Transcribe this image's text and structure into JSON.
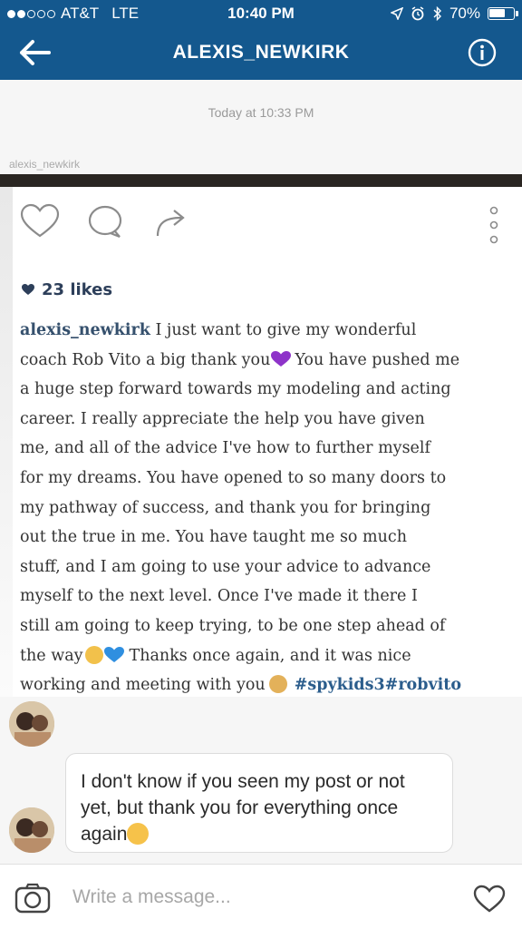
{
  "status_bar": {
    "carrier": "AT&T",
    "network": "LTE",
    "time": "10:40 PM",
    "battery": "70%",
    "battery_level": 0.7
  },
  "nav": {
    "title": "ALEXIS_NEWKIRK",
    "back_icon": "back-arrow-icon",
    "info_icon": "info-icon"
  },
  "thread": {
    "timestamp": "Today at 10:33 PM",
    "shared_from": "alexis_newkirk",
    "post": {
      "likes": "23 likes",
      "caption_lines": [
        "I just want to give my wonderful",
        "coach Rob Vito a big thank you",
        "a huge step forward towards my modeling and acting",
        "career. I really appreciate the help you have given",
        "me, and all of the advice I've how to further myself",
        "for my dreams. You have opened to so many doors to",
        "my pathway of success, and thank you for bringing",
        "out the true in me. You have taught me so much",
        "stuff, and I am going to use your advice to advance",
        "myself to the next level. Once I've made it there I",
        "still am going to keep trying, to be one step ahead of",
        "the way",
        "working and meeting with you"
      ],
      "caption_user": "alexis_newkirk",
      "caption_line2_tail": "You have pushed me",
      "caption_line12_tail": "Thanks once again, and it was nice",
      "hashtags": "#spykids3#robvito"
    },
    "message": {
      "text": "I don't know if you seen my post or not yet, but thank you for everything once again"
    }
  },
  "composer": {
    "placeholder": "Write a message...",
    "camera_icon": "camera-icon",
    "like_icon": "heart-icon"
  },
  "colors": {
    "header": "#14588e",
    "link": "#35506d",
    "emoji_heart": "#8e33c9"
  }
}
